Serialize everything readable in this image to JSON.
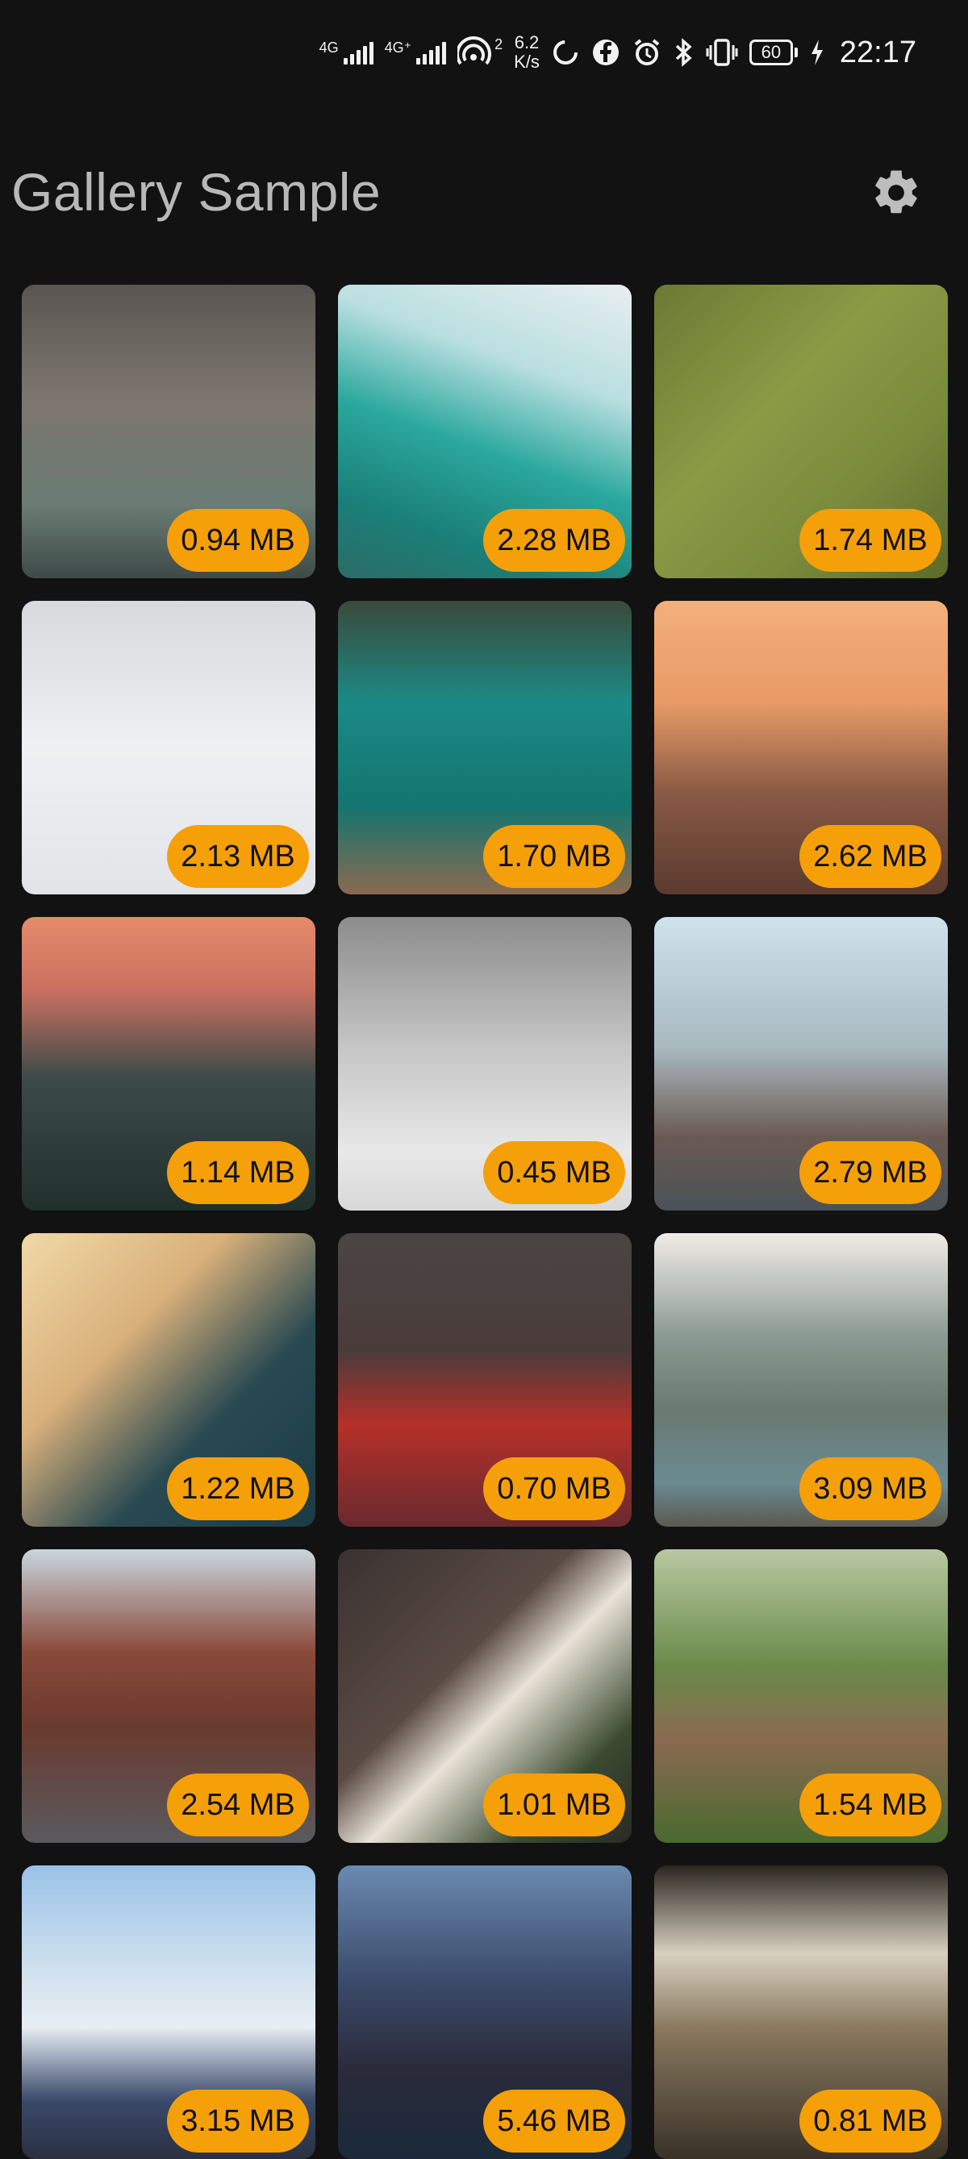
{
  "status_bar": {
    "network_1": "4G",
    "network_2": "4G⁺",
    "hotspot_count": "2",
    "speed_value": "6.2",
    "speed_unit": "K/s",
    "battery_level": "60",
    "time": "22:17",
    "icons": [
      "signal-icon",
      "signal-icon",
      "hotspot-icon",
      "sync-icon",
      "facebook-icon",
      "alarm-icon",
      "bluetooth-icon",
      "vibrate-icon",
      "battery-icon",
      "charging-icon"
    ]
  },
  "app_bar": {
    "title": "Gallery Sample",
    "settings_icon": "gear-icon"
  },
  "gallery": {
    "items": [
      {
        "size": "0.94 MB",
        "bg": "linear-gradient(180deg,#5a5550 0%,#7d7770 40%,#6a7c74 75%,#3e4a47 100%)"
      },
      {
        "size": "2.28 MB",
        "bg": "linear-gradient(200deg,#e8eef0 0%,#b9dfe0 30%,#2aa89d 55%,#1a7f78 80%,#2d6c66 100%)"
      },
      {
        "size": "1.74 MB",
        "bg": "linear-gradient(135deg,#6b7a33 0%,#8b9a45 40%,#7a8a3c 70%,#5c6a2a 100%)"
      },
      {
        "size": "2.13 MB",
        "bg": "linear-gradient(180deg,#d7d9dd 0%,#eef0f2 50%,#e2e4e8 100%)"
      },
      {
        "size": "1.70 MB",
        "bg": "linear-gradient(180deg,#3a4a3a 0%,#1b8a86 35%,#14756f 70%,#8a6a50 100%)"
      },
      {
        "size": "2.62 MB",
        "bg": "linear-gradient(180deg,#f4b07a 0%,#e89a66 35%,#8a5a44 65%,#5a3a30 100%)"
      },
      {
        "size": "1.14 MB",
        "bg": "linear-gradient(180deg,#e58a6a 0%,#c97060 25%,#3c4a48 55%,#22302c 100%)"
      },
      {
        "size": "0.45 MB",
        "bg": "linear-gradient(180deg,#8c8c8c 0%,#c6c6c6 45%,#e8e8e8 80%,#d8d8d8 100%)"
      },
      {
        "size": "2.79 MB",
        "bg": "linear-gradient(180deg,#cfe3ec 0%,#a8b8bf 45%,#6a5a52 75%,#4a5258 100%)"
      },
      {
        "size": "1.22 MB",
        "bg": "linear-gradient(135deg,#f1d9a8 0%,#d8b07a 35%,#2a4a52 65%,#1c3a44 100%)"
      },
      {
        "size": "0.70 MB",
        "bg": "linear-gradient(180deg,#4a4544 0%,#4a3c3a 40%,#b5302a 65%,#6a2a2e 100%)"
      },
      {
        "size": "3.09 MB",
        "bg": "linear-gradient(180deg,#f2ece8 0%,#8a9a92 35%,#6a7a70 60%,#6b8a92 85%,#5a5a50 100%)"
      },
      {
        "size": "2.54 MB",
        "bg": "linear-gradient(180deg,#c9d6de 0%,#8a4a3a 35%,#6a3a2e 60%,#5a5a5e 100%)"
      },
      {
        "size": "1.01 MB",
        "bg": "linear-gradient(135deg,#3a3230 0%,#5a4a44 40%,#e8e2d8 55%,#3a4a30 80%,#2a2a26 100%)"
      },
      {
        "size": "1.54 MB",
        "bg": "linear-gradient(180deg,#b8c8a0 0%,#6a8a4a 40%,#8a6a50 65%,#4a6a30 100%)"
      },
      {
        "size": "3.15 MB",
        "bg": "linear-gradient(180deg,#9ac2e8 0%,#cfe0ee 35%,#e8eef4 55%,#3a4a6a 80%,#2a3040 100%)"
      },
      {
        "size": "5.46 MB",
        "bg": "linear-gradient(180deg,#6a8ab0 0%,#3a4a6a 40%,#2a2a3a 70%,#1a2a3a 100%)"
      },
      {
        "size": "0.81 MB",
        "bg": "linear-gradient(180deg,#2a2620 0%,#d8d0c0 30%,#8a7a60 55%,#3a3228 100%)"
      }
    ]
  }
}
